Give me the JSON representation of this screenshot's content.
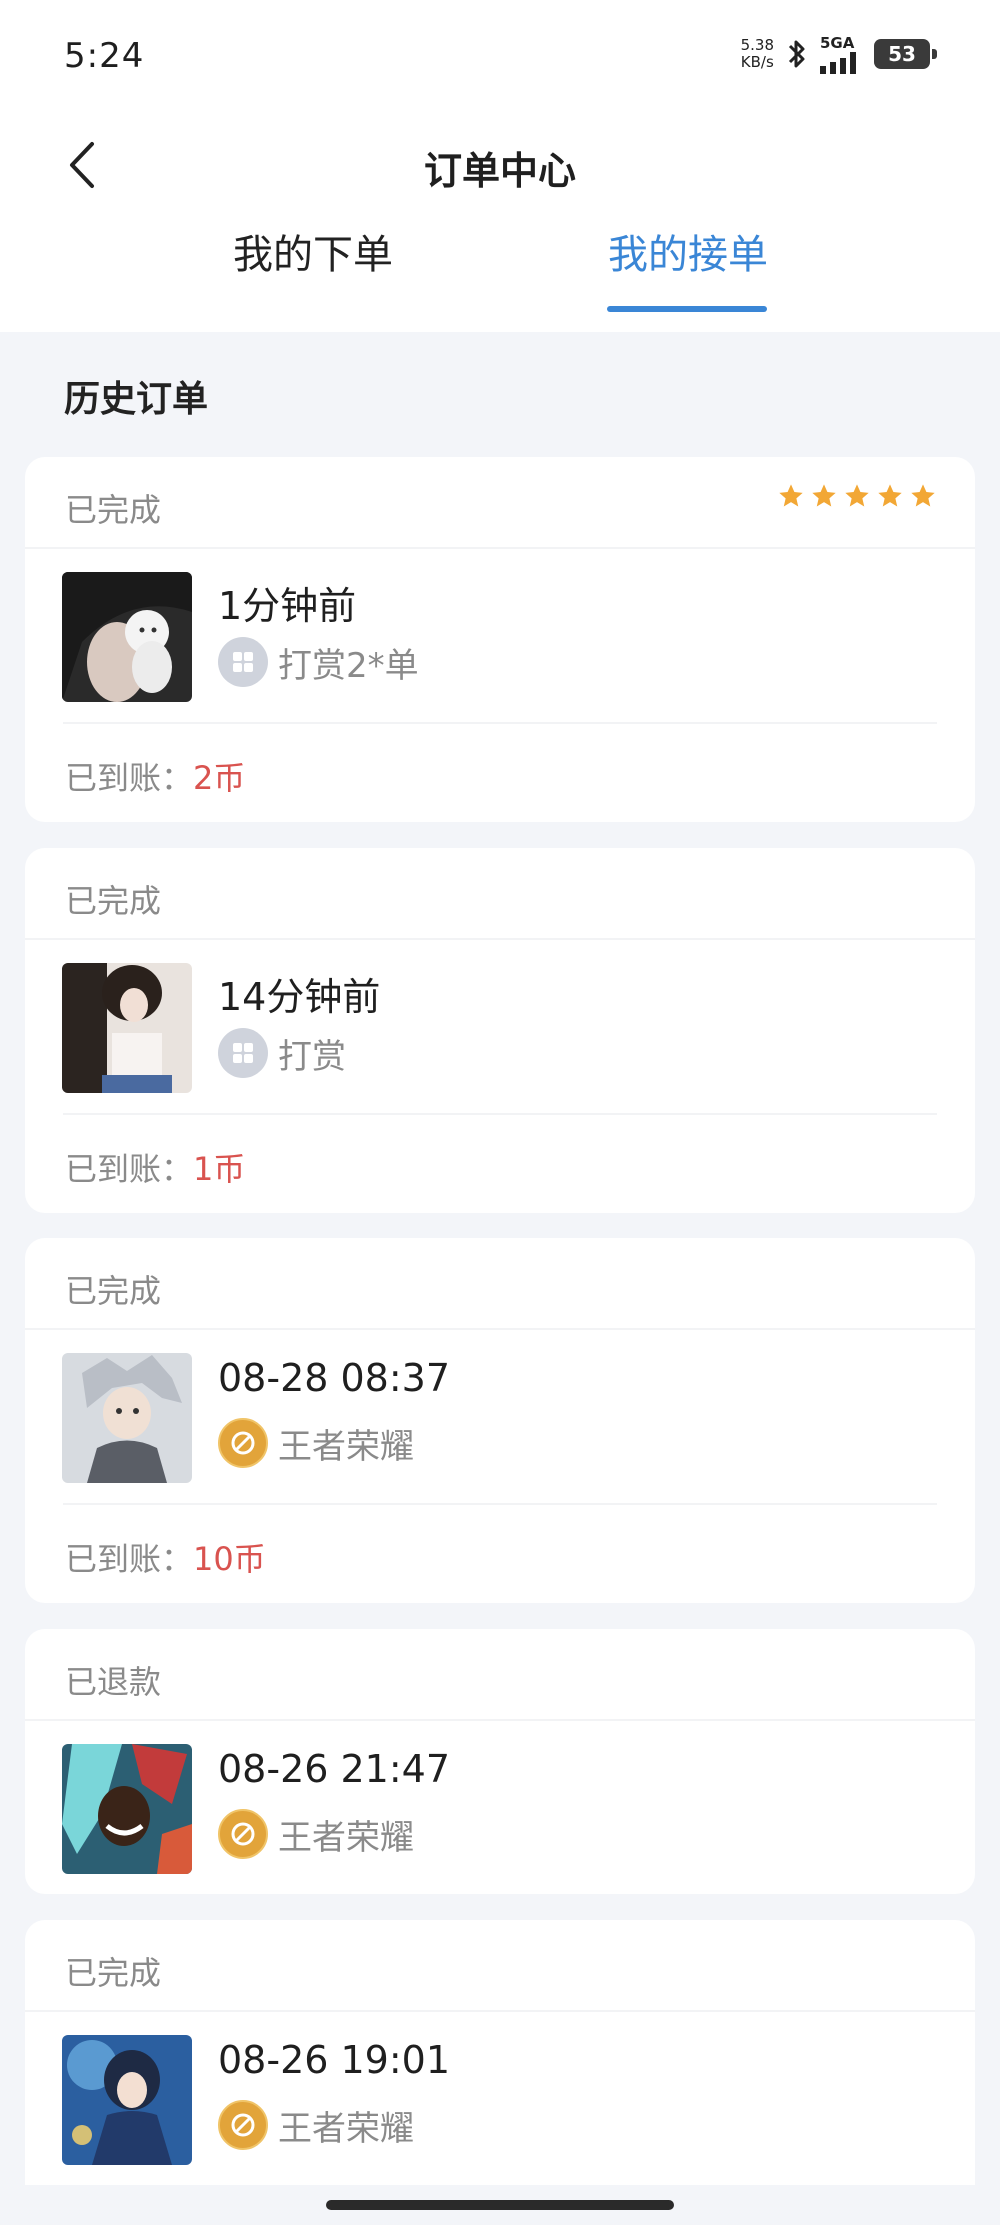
{
  "status_bar": {
    "time": "5:24",
    "speed_value": "5.38",
    "speed_unit": "KB/s",
    "network": "5GA",
    "battery": "53"
  },
  "header": {
    "title": "订单中心"
  },
  "tabs": [
    {
      "label": "我的下单",
      "active": false
    },
    {
      "label": "我的接单",
      "active": true
    }
  ],
  "section_title": "历史订单",
  "colors": {
    "accent": "#3a86d6",
    "amount": "#d9534f",
    "star": "#f2a735"
  },
  "orders": [
    {
      "status": "已完成",
      "rating_stars": 5,
      "time": "1分钟前",
      "game": "打赏2*单",
      "game_icon": "grid-icon",
      "paid_label": "已到账：",
      "paid_amount": "2币"
    },
    {
      "status": "已完成",
      "time": "14分钟前",
      "game": "打赏",
      "game_icon": "grid-icon",
      "paid_label": "已到账：",
      "paid_amount": "1币"
    },
    {
      "status": "已完成",
      "time": "08-28 08:37",
      "game": "王者荣耀",
      "game_icon": "honor-of-kings-icon",
      "paid_label": "已到账：",
      "paid_amount": "10币"
    },
    {
      "status": "已退款",
      "time": "08-26 21:47",
      "game": "王者荣耀",
      "game_icon": "honor-of-kings-icon"
    },
    {
      "status": "已完成",
      "time": "08-26 19:01",
      "game": "王者荣耀",
      "game_icon": "honor-of-kings-icon"
    }
  ]
}
